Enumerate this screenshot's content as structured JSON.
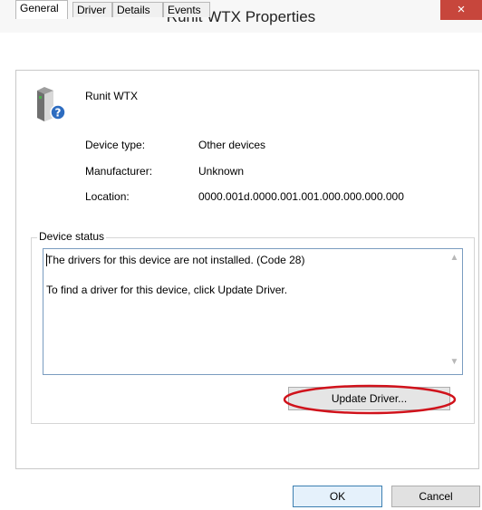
{
  "window": {
    "title": "Runit WTX Properties",
    "close_glyph": "×"
  },
  "tabs": [
    {
      "label": "General",
      "active": true
    },
    {
      "label": "Driver",
      "active": false
    },
    {
      "label": "Details",
      "active": false
    },
    {
      "label": "Events",
      "active": false
    }
  ],
  "device": {
    "name": "Runit WTX",
    "icon": "unknown-device-icon",
    "properties": [
      {
        "label": "Device type:",
        "value": "Other devices"
      },
      {
        "label": "Manufacturer:",
        "value": "Unknown"
      },
      {
        "label": "Location:",
        "value": "0000.001d.0000.001.001.000.000.000.000"
      }
    ]
  },
  "status": {
    "group_label": "Device status",
    "lines": [
      "The drivers for this device are not installed. (Code 28)",
      "To find a driver for this device, click Update Driver."
    ]
  },
  "buttons": {
    "update_driver": "Update Driver...",
    "ok": "OK",
    "cancel": "Cancel"
  },
  "colors": {
    "close_button": "#c7463c",
    "highlight_circle": "#d0121b",
    "ok_border": "#3c7fb1"
  }
}
